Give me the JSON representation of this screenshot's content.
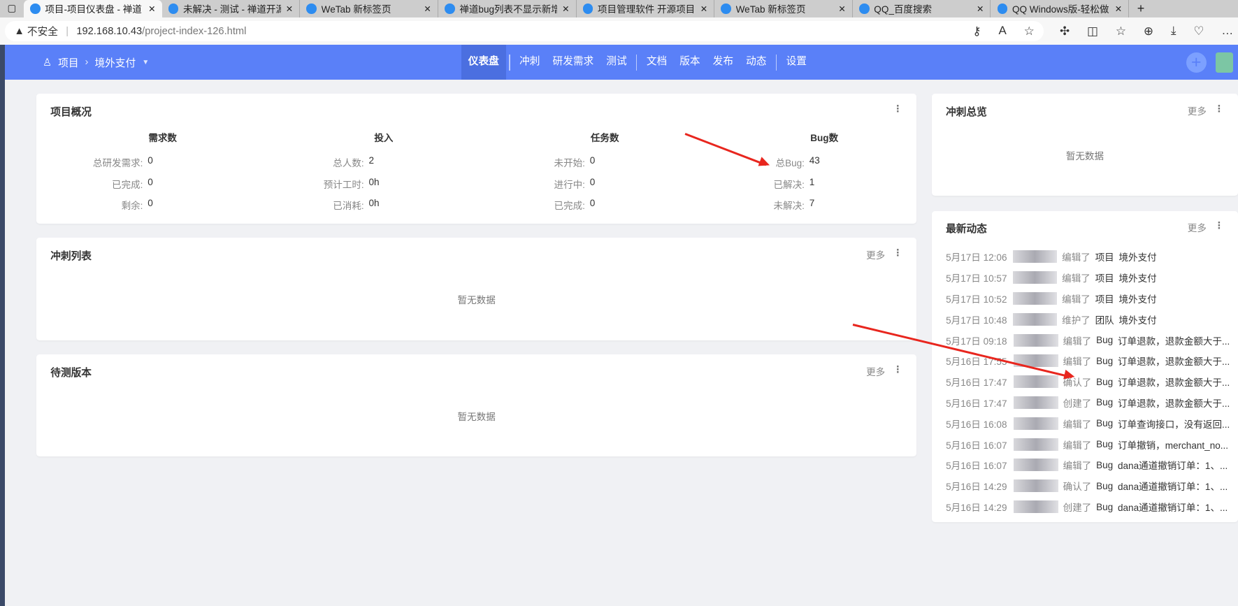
{
  "browser": {
    "tabs": [
      {
        "title": "项目-项目仪表盘 - 禅道",
        "active": true
      },
      {
        "title": "未解决 - 测试 - 禅道开源"
      },
      {
        "title": "WeTab 新标签页"
      },
      {
        "title": "禅道bug列表不显示新增"
      },
      {
        "title": "项目管理软件 开源项目管"
      },
      {
        "title": "WeTab 新标签页"
      },
      {
        "title": "QQ_百度搜索"
      },
      {
        "title": "QQ Windows版-轻松做自"
      }
    ],
    "security": "不安全",
    "url_host": "192.168.10.43",
    "url_path": "/project-index-126.html"
  },
  "nav": {
    "breadcrumb_root": "项目",
    "project": "境外支付",
    "menu": [
      "仪表盘",
      "冲刺",
      "研发需求",
      "测试",
      "文档",
      "版本",
      "发布",
      "动态",
      "设置"
    ]
  },
  "overview": {
    "title": "项目概况",
    "columns": [
      {
        "title": "需求数",
        "rows": [
          [
            "总研发需求:",
            "0"
          ],
          [
            "已完成:",
            "0"
          ],
          [
            "剩余:",
            "0"
          ]
        ]
      },
      {
        "title": "投入",
        "rows": [
          [
            "总人数:",
            "2"
          ],
          [
            "预计工时:",
            "0h"
          ],
          [
            "已消耗:",
            "0h"
          ]
        ]
      },
      {
        "title": "任务数",
        "rows": [
          [
            "未开始:",
            "0"
          ],
          [
            "进行中:",
            "0"
          ],
          [
            "已完成:",
            "0"
          ]
        ]
      },
      {
        "title": "Bug数",
        "rows": [
          [
            "总Bug:",
            "43"
          ],
          [
            "已解决:",
            "1"
          ],
          [
            "未解决:",
            "7"
          ]
        ]
      }
    ]
  },
  "sprint_list": {
    "title": "冲刺列表",
    "more": "更多",
    "empty": "暂无数据"
  },
  "test_builds": {
    "title": "待测版本",
    "more": "更多",
    "empty": "暂无数据"
  },
  "sprint_overview": {
    "title": "冲刺总览",
    "more": "更多",
    "empty": "暂无数据"
  },
  "dynamics": {
    "title": "最新动态",
    "more": "更多",
    "items": [
      {
        "time": "5月17日 12:06",
        "action": "编辑了",
        "type": "项目",
        "name": "境外支付"
      },
      {
        "time": "5月17日 10:57",
        "action": "编辑了",
        "type": "项目",
        "name": "境外支付"
      },
      {
        "time": "5月17日 10:52",
        "action": "编辑了",
        "type": "项目",
        "name": "境外支付"
      },
      {
        "time": "5月17日 10:48",
        "action": "维护了",
        "type": "团队",
        "name": "境外支付"
      },
      {
        "time": "5月17日 09:18",
        "action": "编辑了",
        "type": "Bug",
        "name": "订单退款，退款金额大于..."
      },
      {
        "time": "5月16日 17:55",
        "action": "编辑了",
        "type": "Bug",
        "name": "订单退款，退款金额大于..."
      },
      {
        "time": "5月16日 17:47",
        "action": "确认了",
        "type": "Bug",
        "name": "订单退款，退款金额大于..."
      },
      {
        "time": "5月16日 17:47",
        "action": "创建了",
        "type": "Bug",
        "name": "订单退款，退款金额大于..."
      },
      {
        "time": "5月16日 16:08",
        "action": "编辑了",
        "type": "Bug",
        "name": "订单查询接口，没有返回..."
      },
      {
        "time": "5月16日 16:07",
        "action": "编辑了",
        "type": "Bug",
        "name": "订单撤销，merchant_no..."
      },
      {
        "time": "5月16日 16:07",
        "action": "编辑了",
        "type": "Bug",
        "name": "dana通道撤销订单：1、..."
      },
      {
        "time": "5月16日 14:29",
        "action": "确认了",
        "type": "Bug",
        "name": "dana通道撤销订单：1、..."
      },
      {
        "time": "5月16日 14:29",
        "action": "创建了",
        "type": "Bug",
        "name": "dana通道撤销订单：1、..."
      }
    ]
  }
}
